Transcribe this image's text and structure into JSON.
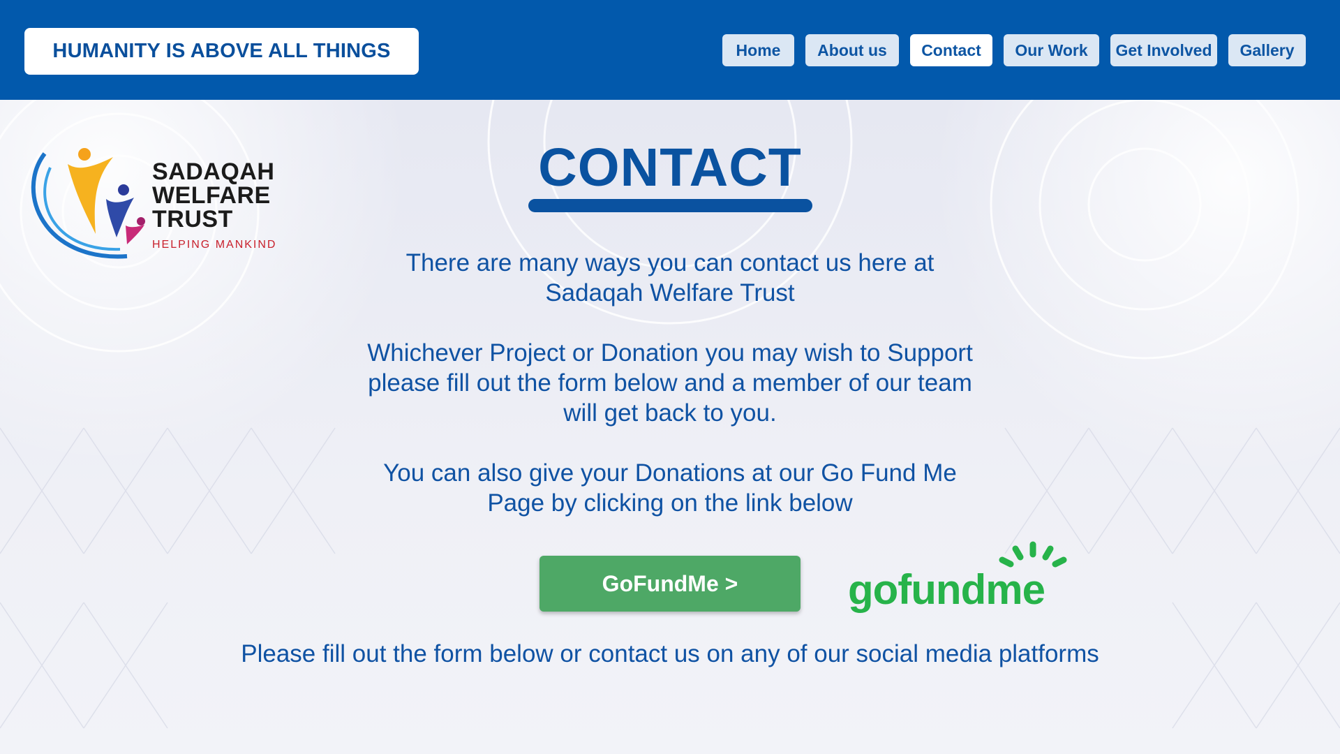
{
  "header": {
    "tagline": "HUMANITY IS ABOVE ALL THINGS",
    "nav": [
      {
        "label": "Home",
        "active": false
      },
      {
        "label": "About us",
        "active": false
      },
      {
        "label": "Contact",
        "active": true
      },
      {
        "label": "Our Work",
        "active": false
      },
      {
        "label": "Get Involved",
        "active": false
      },
      {
        "label": "Gallery",
        "active": false
      }
    ]
  },
  "logo": {
    "line1": "SADAQAH",
    "line2": "WELFARE",
    "line3": "TRUST",
    "tagline": "HELPING MANKIND"
  },
  "main": {
    "title": "CONTACT",
    "para1": "There are many ways you can contact us here at Sadaqah Welfare Trust",
    "para2": "Whichever Project or Donation you may wish to Support please fill out the form below and a member of our team will get back to you.",
    "para3": "You can also give your Donations at our Go Fund Me Page by clicking on the link below",
    "gofundme_button": "GoFundMe >",
    "gofundme_logo": "gofundme",
    "footer_text": "Please fill out the form below or contact us on any of our social media platforms"
  },
  "colors": {
    "header_blue": "#0259ac",
    "text_blue": "#0f52a3",
    "button_green": "#4ea866",
    "gofundme_green": "#27b34a"
  }
}
